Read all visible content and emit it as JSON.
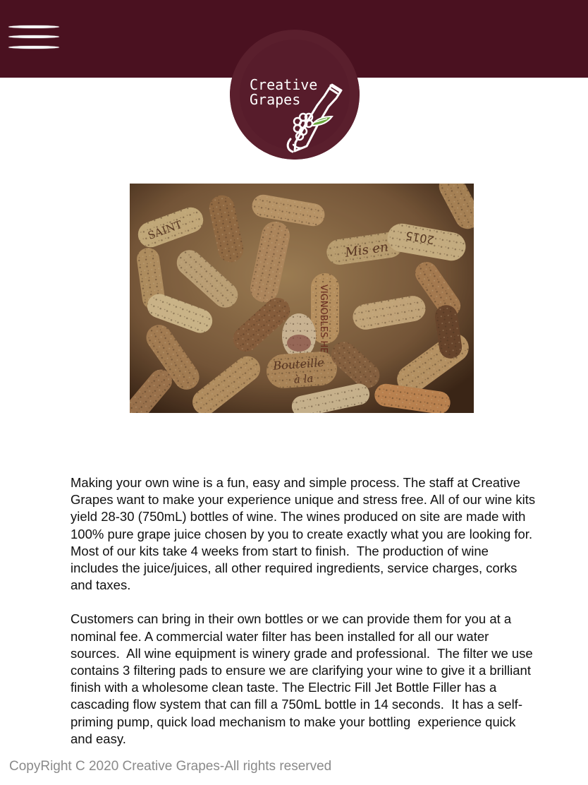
{
  "header": {
    "background_color": "#4a1120",
    "menu_icon": "hamburger-menu-icon",
    "logo": {
      "line1": "Creative",
      "line2": "Grapes",
      "circle_color": "#5a1f2d",
      "icon": "wine-bottle-with-grapes-icon"
    }
  },
  "hero_image": {
    "subject": "wine-corks"
  },
  "content": {
    "paragraph1": "Making your own wine is a fun, easy and simple process. The staff at Creative Grapes want to make your experience unique and stress free. All of our wine kits yield 28-30 (750mL) bottles of wine. The wines produced on site are made with 100% pure grape juice chosen by you to create exactly what you are looking for.  Most of our kits take 4 weeks from start to finish.  The production of wine includes the juice/juices, all other required ingredients, service charges, corks and taxes.",
    "paragraph2": "Customers can bring in their own bottles or we can provide them for you at a nominal fee. A commercial water filter has been installed for all our water sources.  All wine equipment is winery grade and professional.  The filter we use contains 3 filtering pads to ensure we are clarifying your wine to give it a brilliant finish with a wholesome clean taste. The Electric Fill Jet Bottle Filler has a cascading flow system that can fill a 750mL bottle in 14 seconds.  It has a self-priming pump, quick load mechanism to make your bottling  experience quick and easy."
  },
  "footer": {
    "text": "CopyRight C 2020 Creative Grapes-All rights reserved"
  }
}
